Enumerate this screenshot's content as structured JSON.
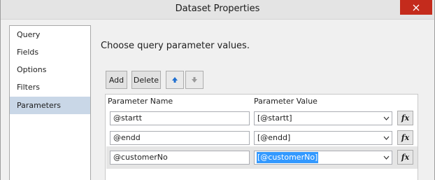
{
  "window": {
    "title": "Dataset Properties",
    "close_icon": "close-icon"
  },
  "nav": {
    "items": [
      {
        "label": "Query"
      },
      {
        "label": "Fields"
      },
      {
        "label": "Options"
      },
      {
        "label": "Filters"
      },
      {
        "label": "Parameters",
        "selected": true
      }
    ]
  },
  "main": {
    "heading": "Choose query parameter values."
  },
  "toolbar": {
    "add_label": "Add",
    "delete_label": "Delete",
    "move_up_icon": "arrow-up-icon",
    "move_down_icon": "arrow-down-icon"
  },
  "grid": {
    "columns": [
      "Parameter Name",
      "Parameter Value"
    ],
    "fx_label": "fx",
    "rows": [
      {
        "name": "@startt",
        "value": "[@startt]"
      },
      {
        "name": "@endd",
        "value": "[@endd]"
      },
      {
        "name": "@customerNo",
        "value": "[@customerNo]",
        "selected": true
      }
    ]
  },
  "colors": {
    "selected_nav": "#c9d7e7",
    "selection_highlight": "#3399ff",
    "close_button": "#c42b1c",
    "arrow_up_enabled": "#1f6fd1",
    "arrow_down_disabled": "#9a9a9a"
  }
}
